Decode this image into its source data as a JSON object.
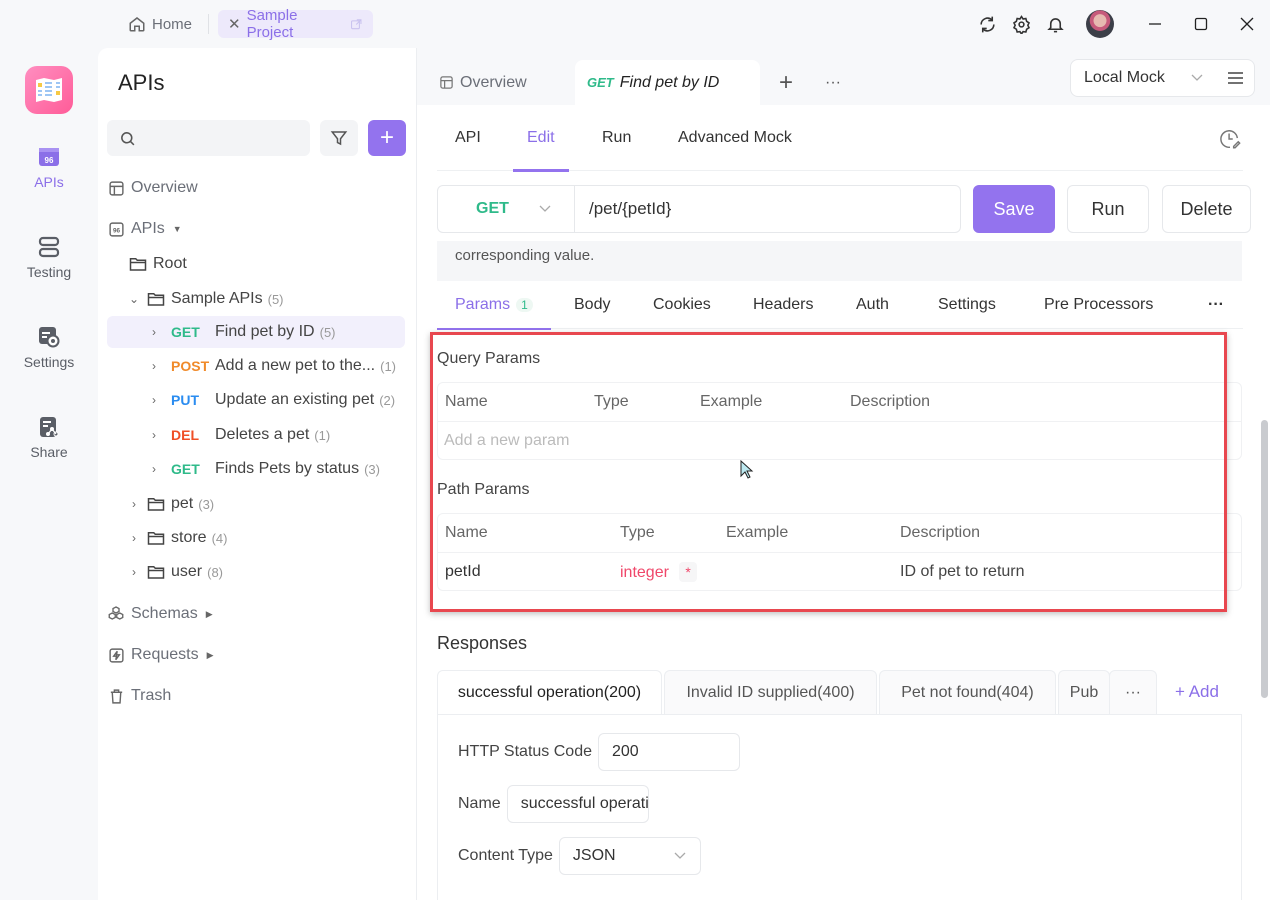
{
  "titlebar": {
    "tabs": [
      {
        "label": "Home",
        "icon": "home-icon"
      },
      {
        "label": "Sample Project",
        "icon": "close-icon",
        "active": true
      }
    ],
    "icons": [
      "sync-icon",
      "gear-icon",
      "bell-icon"
    ],
    "window_controls": [
      "minimize",
      "maximize",
      "close"
    ]
  },
  "rail": {
    "items": [
      {
        "label": "APIs",
        "icon": "apis-icon",
        "active": true
      },
      {
        "label": "Testing",
        "icon": "testing-icon"
      },
      {
        "label": "Settings",
        "icon": "settings-icon"
      },
      {
        "label": "Share",
        "icon": "share-icon"
      }
    ]
  },
  "sidebar": {
    "title": "APIs",
    "search_placeholder": "",
    "tree": {
      "overview": "Overview",
      "apis": "APIs",
      "root": "Root",
      "sample_folder": {
        "label": "Sample APIs",
        "count": "(5)"
      },
      "endpoints": [
        {
          "method": "GET",
          "label": "Find pet by ID",
          "count": "(5)",
          "selected": true
        },
        {
          "method": "POST",
          "label": "Add a new pet to the...",
          "count": "(1)"
        },
        {
          "method": "PUT",
          "label": "Update an existing pet",
          "count": "(2)"
        },
        {
          "method": "DEL",
          "label": "Deletes a pet",
          "count": "(1)"
        },
        {
          "method": "GET",
          "label": "Finds Pets by status",
          "count": "(3)"
        }
      ],
      "folders": [
        {
          "label": "pet",
          "count": "(3)"
        },
        {
          "label": "store",
          "count": "(4)"
        },
        {
          "label": "user",
          "count": "(8)"
        }
      ],
      "schemas": "Schemas",
      "requests": "Requests",
      "trash": "Trash"
    }
  },
  "main": {
    "doc_tabs": {
      "overview": "Overview",
      "active_method": "GET",
      "active_label": "Find pet by ID"
    },
    "environment": "Local Mock",
    "sub_tabs": [
      "API",
      "Edit",
      "Run",
      "Advanced Mock"
    ],
    "active_sub_tab": "Edit",
    "method": "GET",
    "url": "/pet/{petId}",
    "buttons": {
      "save": "Save",
      "run": "Run",
      "delete": "Delete"
    },
    "description_tail": "corresponding value.",
    "request_tabs": [
      "Params",
      "Body",
      "Cookies",
      "Headers",
      "Auth",
      "Settings",
      "Pre Processors"
    ],
    "params_badge": "1",
    "more": "···",
    "query_params": {
      "title": "Query Params",
      "headers": [
        "Name",
        "Type",
        "Example",
        "Description"
      ],
      "placeholder": "Add a new param"
    },
    "path_params": {
      "title": "Path Params",
      "headers": [
        "Name",
        "Type",
        "Example",
        "Description"
      ],
      "rows": [
        {
          "name": "petId",
          "type": "integer",
          "required": "*",
          "example": "",
          "description": "ID of pet to return"
        }
      ]
    },
    "responses": {
      "title": "Responses",
      "tabs": [
        "successful operation(200)",
        "Invalid ID supplied(400)",
        "Pet not found(404)",
        "Pub"
      ],
      "more": "···",
      "add": "+ Add",
      "form": {
        "status_label": "HTTP Status Code",
        "status_value": "200",
        "name_label": "Name",
        "name_value": "successful operation",
        "content_type_label": "Content Type",
        "content_type_value": "JSON"
      }
    }
  },
  "colors": {
    "accent": "#9373ee",
    "get": "#2fba8a",
    "post": "#f08a2a",
    "put": "#2a8cf0",
    "delete": "#ef4f26",
    "highlight": "#e8474f"
  }
}
